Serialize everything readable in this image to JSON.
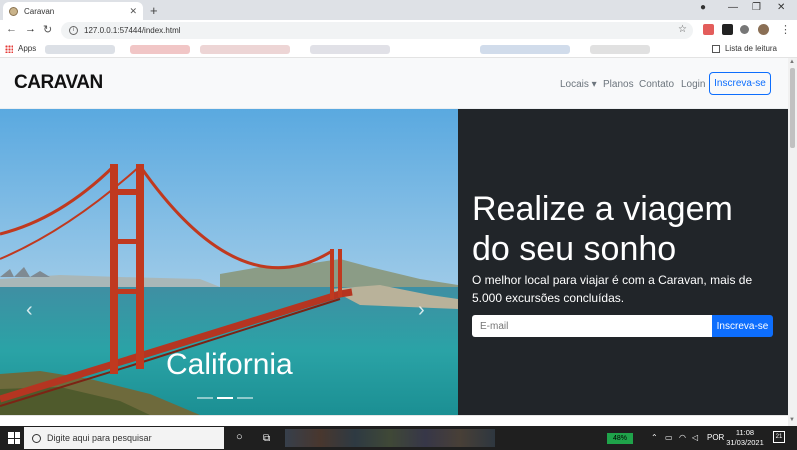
{
  "browser": {
    "tab_title": "Caravan",
    "tab_close": "✕",
    "new_tab": "+",
    "url": "127.0.0.1:57444/index.html",
    "bookmarks_apps": "Apps",
    "reading_list": "Lista de leitura"
  },
  "site": {
    "brand": "CARAVAN",
    "nav": {
      "locais": "Locais ▾",
      "planos": "Planos",
      "contato": "Contato",
      "login": "Login",
      "signup": "Inscreva-se"
    },
    "hero": {
      "headline": "Realize a viagem do seu sonho",
      "subtext": "O melhor local para viajar é com a Caravan, mais de 5.000 excursões concluídas.",
      "email_placeholder": "E-mail",
      "submit": "Inscreva-se"
    },
    "carousel": {
      "caption": "California",
      "prev": "‹",
      "next": "›",
      "slides": 3,
      "active_slide": 2
    }
  },
  "taskbar": {
    "search_placeholder": "Digite aqui para pesquisar",
    "battery": "48%",
    "language": "POR",
    "time": "11:08",
    "date": "31/03/2021",
    "notifications": "21"
  },
  "colors": {
    "primary": "#0d6efd",
    "hero_dark": "#212529",
    "navbar_bg": "#f8f9fa"
  }
}
